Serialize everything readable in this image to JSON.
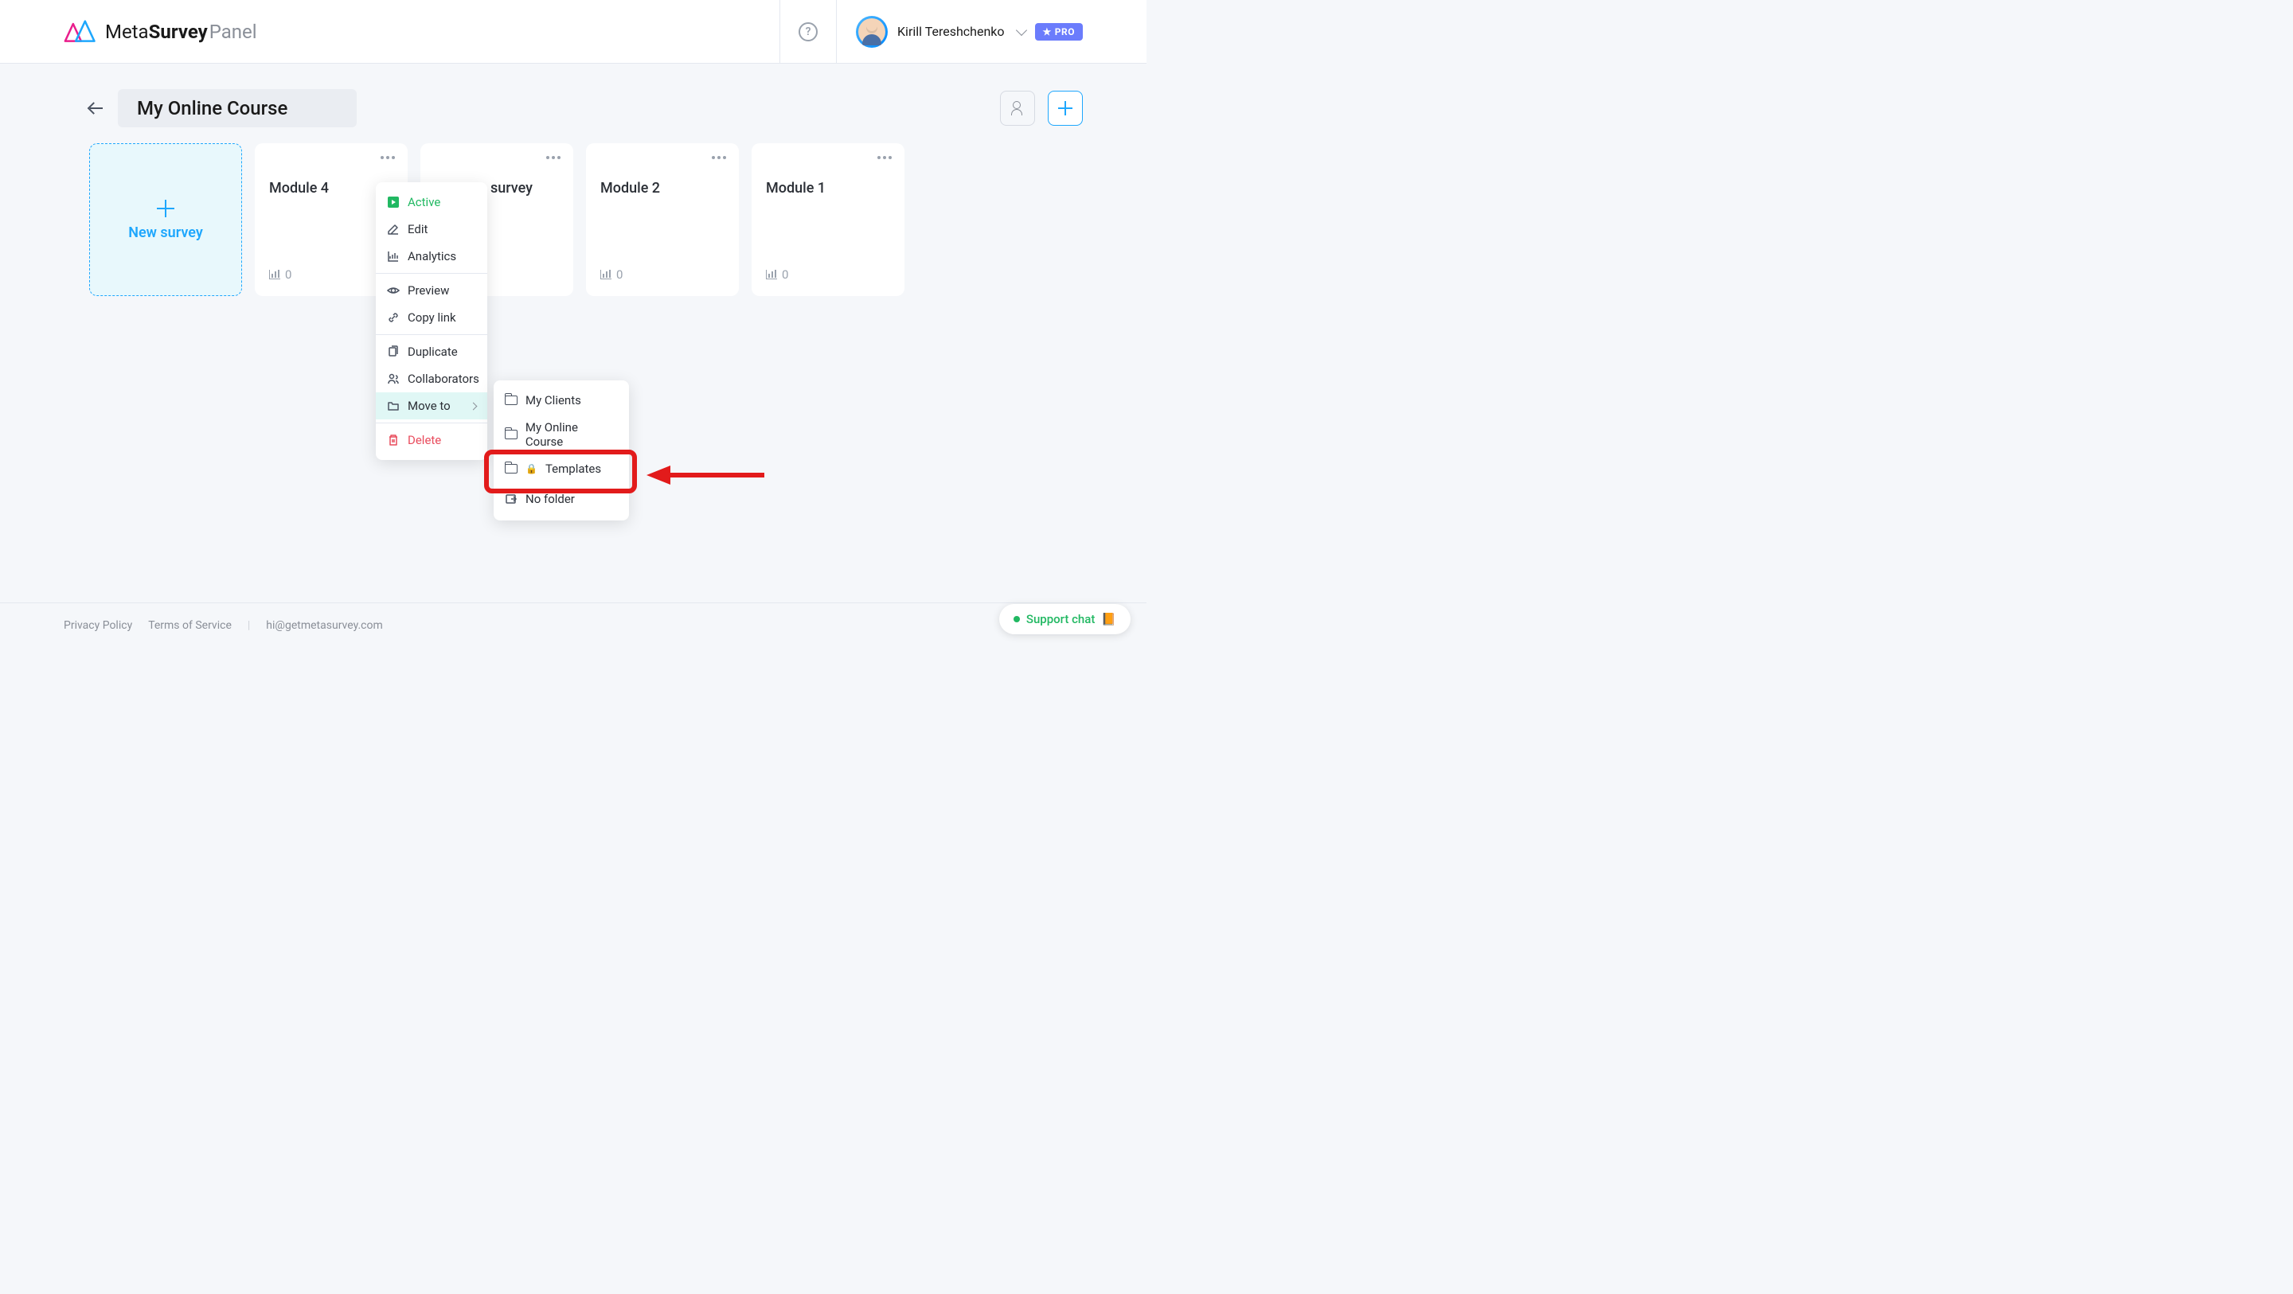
{
  "header": {
    "logo_meta": "Meta",
    "logo_survey": "Survey",
    "logo_panel": "Panel",
    "user_name": "Kirill Tereshchenko",
    "pro_badge": "PRO"
  },
  "toolbar": {
    "folder_title": "My Online Course"
  },
  "new_survey_label": "New survey",
  "cards": [
    {
      "title": "Module 4",
      "count": "0"
    },
    {
      "title": "survey",
      "count": ""
    },
    {
      "title": "Module 2",
      "count": "0"
    },
    {
      "title": "Module 1",
      "count": "0"
    }
  ],
  "dropdown": {
    "active": "Active",
    "edit": "Edit",
    "analytics": "Analytics",
    "preview": "Preview",
    "copy_link": "Copy link",
    "duplicate": "Duplicate",
    "collaborators": "Collaborators",
    "move_to": "Move to",
    "delete": "Delete"
  },
  "submenu": {
    "items": [
      {
        "label": "My Clients",
        "locked": false
      },
      {
        "label": "My Online Course",
        "locked": false
      },
      {
        "label": "Templates",
        "locked": true
      }
    ],
    "no_folder": "No folder"
  },
  "footer": {
    "privacy": "Privacy Policy",
    "terms": "Terms of Service",
    "email": "hi@getmetasurvey.com"
  },
  "support_chat": "Support chat"
}
